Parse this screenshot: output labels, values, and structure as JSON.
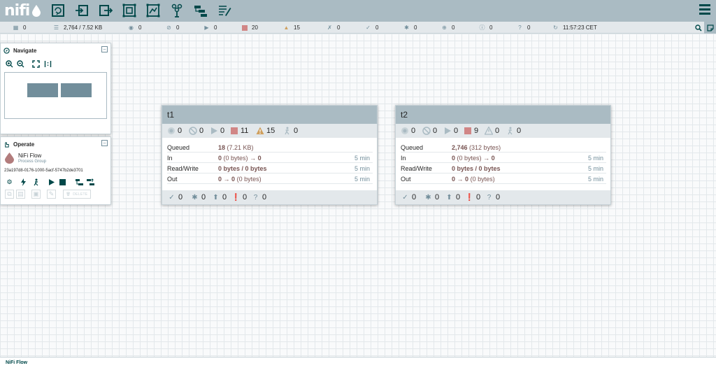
{
  "header": {
    "logo_text": "nifi",
    "toolbar": [
      {
        "name": "processor-icon"
      },
      {
        "name": "input-port-icon"
      },
      {
        "name": "output-port-icon"
      },
      {
        "name": "process-group-icon"
      },
      {
        "name": "remote-process-group-icon"
      },
      {
        "name": "funnel-icon"
      },
      {
        "name": "template-icon"
      },
      {
        "name": "label-icon"
      }
    ]
  },
  "status": {
    "active_threads": "0",
    "queued": "2,764 / 7.52 KB",
    "transmitting": "0",
    "not_transmitting": "0",
    "running": "0",
    "stopped": "20",
    "invalid": "15",
    "disabled": "0",
    "up_to_date": "0",
    "locally_modified": "0",
    "stale": "0",
    "locally_modified_stale": "0",
    "sync_failure": "0",
    "refresh_time": "11:57:23 CET"
  },
  "navigate": {
    "title": "Navigate"
  },
  "operate": {
    "title": "Operate",
    "name": "NiFi Flow",
    "type": "Process Group",
    "id": "23a197d8-0176-1000-5acf-5747b2de3701",
    "delete_label": "DELETE"
  },
  "groups": [
    {
      "title": "t1",
      "stats": {
        "transmitting": "0",
        "not_transmitting": "0",
        "running": "0",
        "stopped": "11",
        "invalid": "15",
        "disabled": "0"
      },
      "rows": {
        "queued_label": "Queued",
        "queued_count": "18",
        "queued_size": "(7.21 KB)",
        "in_label": "In",
        "in_count": "0",
        "in_size": "(0 bytes)",
        "in_arrow": "→",
        "in_ports": "0",
        "in_time": "5 min",
        "rw_label": "Read/Write",
        "rw_value": "0 bytes / 0 bytes",
        "rw_time": "5 min",
        "out_label": "Out",
        "out_ports": "0",
        "out_arrow": "→",
        "out_count": "0",
        "out_size": "(0 bytes)",
        "out_time": "5 min"
      },
      "footer": {
        "up_to_date": "0",
        "locally_modified": "0",
        "stale": "0",
        "locally_modified_stale": "0",
        "sync_failure": "0"
      }
    },
    {
      "title": "t2",
      "stats": {
        "transmitting": "0",
        "not_transmitting": "0",
        "running": "0",
        "stopped": "9",
        "invalid": "0",
        "disabled": "0"
      },
      "rows": {
        "queued_label": "Queued",
        "queued_count": "2,746",
        "queued_size": "(312 bytes)",
        "in_label": "In",
        "in_count": "0",
        "in_size": "(0 bytes)",
        "in_arrow": "→",
        "in_ports": "0",
        "in_time": "5 min",
        "rw_label": "Read/Write",
        "rw_value": "0 bytes / 0 bytes",
        "rw_time": "5 min",
        "out_label": "Out",
        "out_ports": "0",
        "out_arrow": "→",
        "out_count": "0",
        "out_size": "(0 bytes)",
        "out_time": "5 min"
      },
      "footer": {
        "up_to_date": "0",
        "locally_modified": "0",
        "stale": "0",
        "locally_modified_stale": "0",
        "sync_failure": "0"
      }
    }
  ],
  "breadcrumb": {
    "label": "NiFi Flow"
  },
  "colors": {
    "header": "#aabbc3",
    "accent": "#004849",
    "stopped": "#d18686",
    "invalid": "#cf9f5d",
    "stat_value": "#775351"
  }
}
